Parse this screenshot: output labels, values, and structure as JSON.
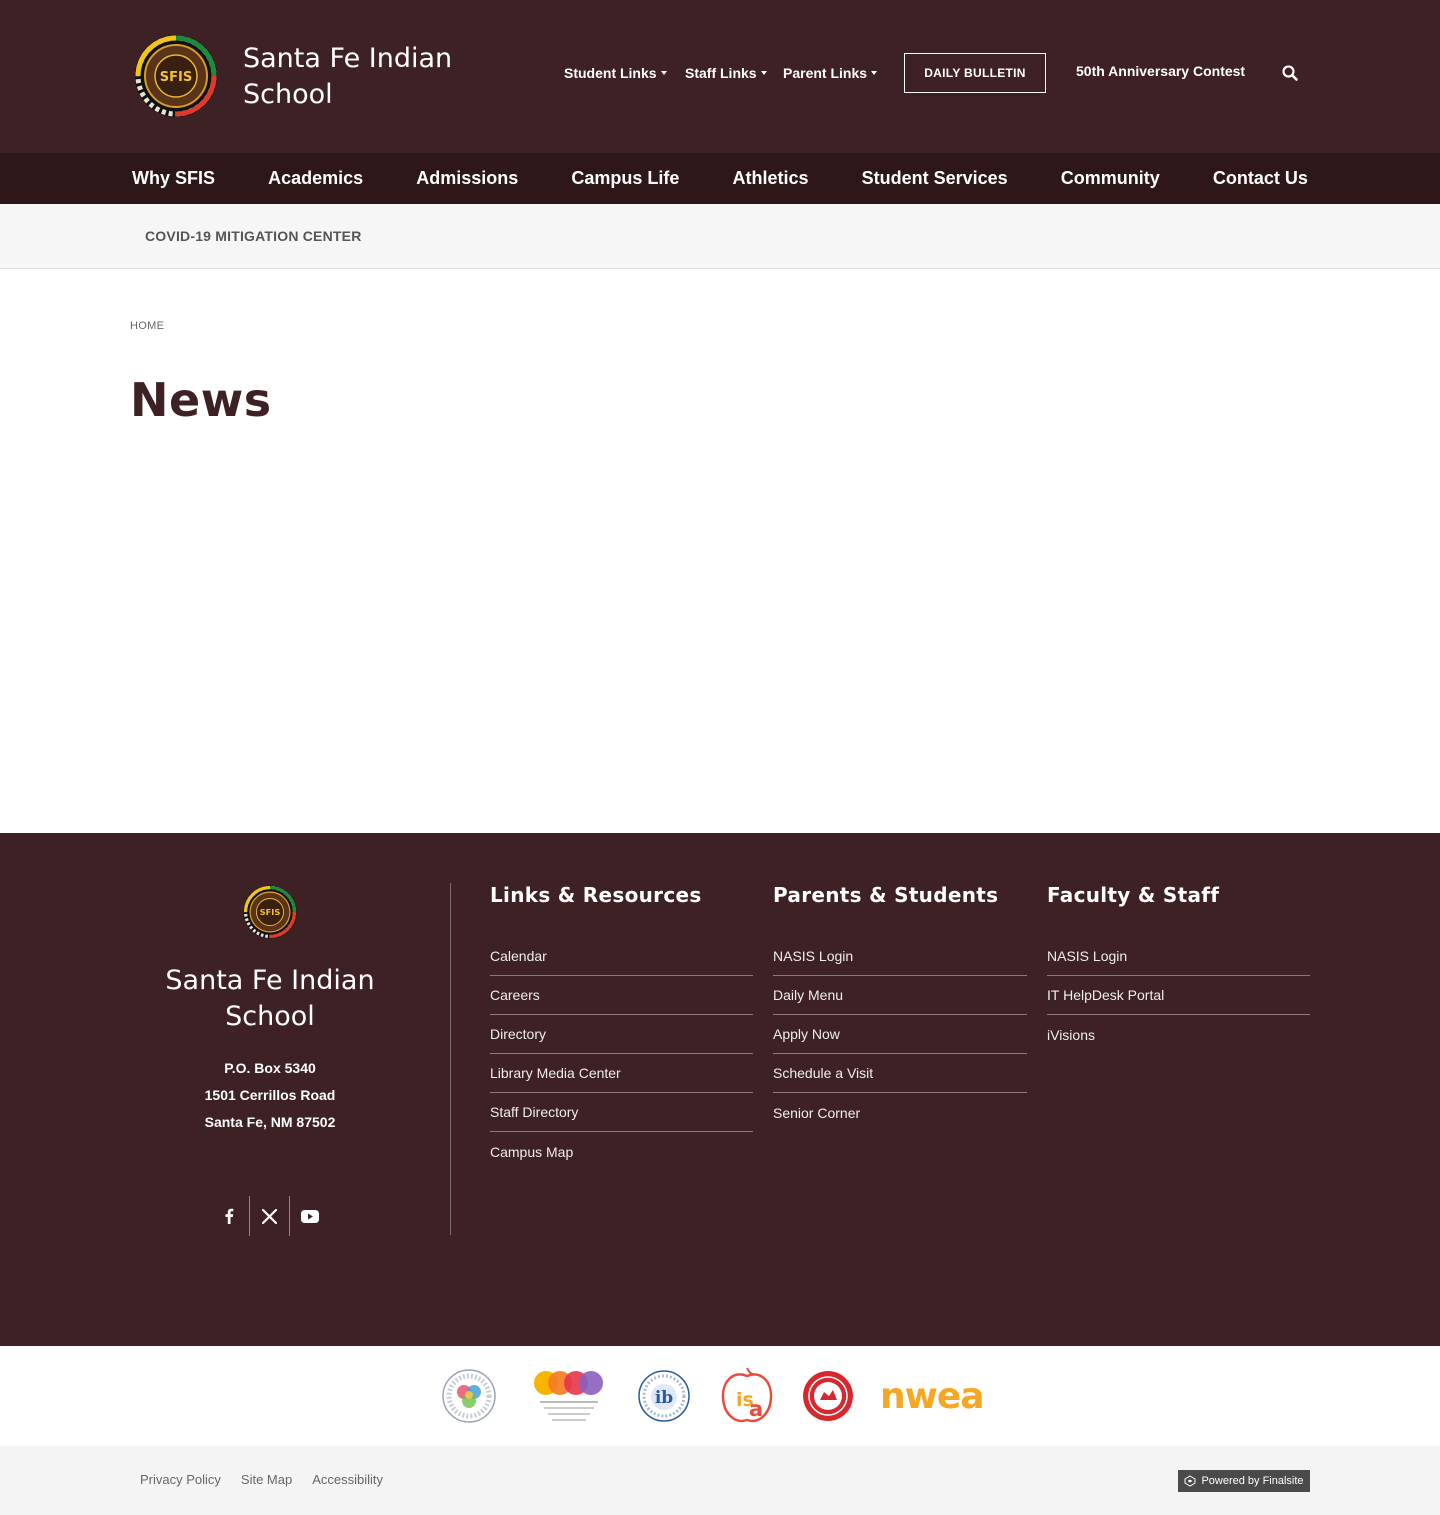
{
  "header": {
    "site_name": "Santa Fe Indian School",
    "logo_text": "SFIS",
    "utility_links": [
      {
        "label": "Student Links"
      },
      {
        "label": "Staff Links"
      },
      {
        "label": "Parent Links"
      }
    ],
    "bulletin_label": "DAILY BULLETIN",
    "anniversary_label": "50th Anniversary Contest",
    "search_icon": "search-icon"
  },
  "main_nav": {
    "items": [
      "Why SFIS",
      "Academics",
      "Admissions",
      "Campus Life",
      "Athletics",
      "Student Services",
      "Community",
      "Contact Us"
    ]
  },
  "sub_nav": {
    "covid_label": "COVID-19 MITIGATION CENTER"
  },
  "content": {
    "breadcrumb": "HOME",
    "title": "News"
  },
  "footer": {
    "site_name": "Santa Fe Indian School",
    "address": [
      "P.O. Box 5340",
      "1501 Cerrillos Road",
      "Santa Fe, NM  87502"
    ],
    "social": [
      "facebook-icon",
      "x-twitter-icon",
      "youtube-icon"
    ],
    "columns": [
      {
        "title": "Links & Resources",
        "links": [
          "Calendar",
          "Careers",
          "Directory",
          "Library Media Center",
          "Staff Directory",
          "Campus Map"
        ]
      },
      {
        "title": "Parents & Students",
        "links": [
          "NASIS Login",
          "Daily Menu",
          "Apply Now",
          "Schedule a Visit",
          "Senior Corner"
        ]
      },
      {
        "title": "Faculty & Staff",
        "links": [
          "NASIS Login",
          "IT HelpDesk Portal",
          "iVisions"
        ]
      }
    ]
  },
  "partners": {
    "nwea_label": "nwea"
  },
  "bottom": {
    "legal_links": [
      "Privacy Policy",
      "Site Map",
      "Accessibility"
    ],
    "powered_label": "Powered by Finalsite"
  },
  "colors": {
    "brand_maroon": "#3e2124",
    "nav_dark": "#2e1719",
    "nwea_orange": "#f5a623"
  }
}
